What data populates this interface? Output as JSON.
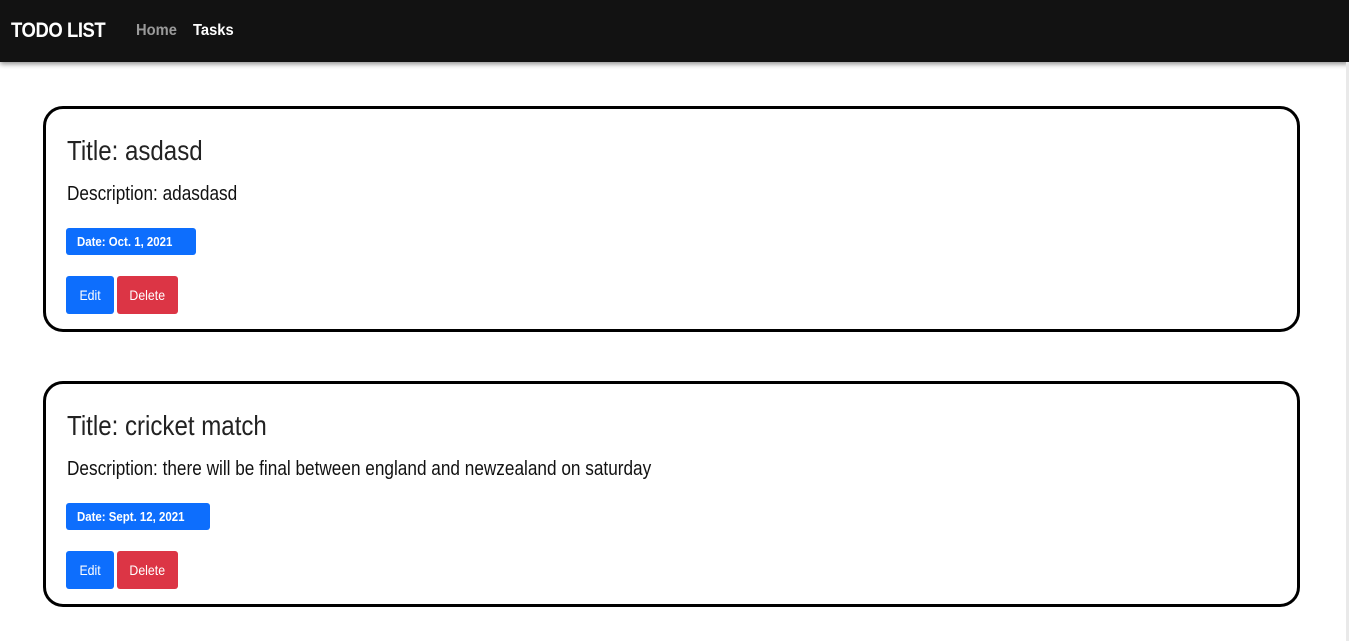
{
  "navbar": {
    "brand": "TODO LIST",
    "links": [
      {
        "label": "Home",
        "active": false
      },
      {
        "label": "Tasks",
        "active": true
      }
    ]
  },
  "tasks": [
    {
      "title": "Title: asdasd",
      "description": "Description: adasdasd",
      "date": "Date: Oct. 1, 2021",
      "edit_label": "Edit",
      "delete_label": "Delete"
    },
    {
      "title": "Title: cricket match",
      "description": "Description: there will be final between england and newzealand on saturday",
      "date": "Date: Sept. 12, 2021",
      "edit_label": "Edit",
      "delete_label": "Delete"
    }
  ],
  "colors": {
    "navbar_bg": "#121212",
    "primary": "#0d6efd",
    "danger": "#dc3545",
    "card_border": "#000000"
  }
}
